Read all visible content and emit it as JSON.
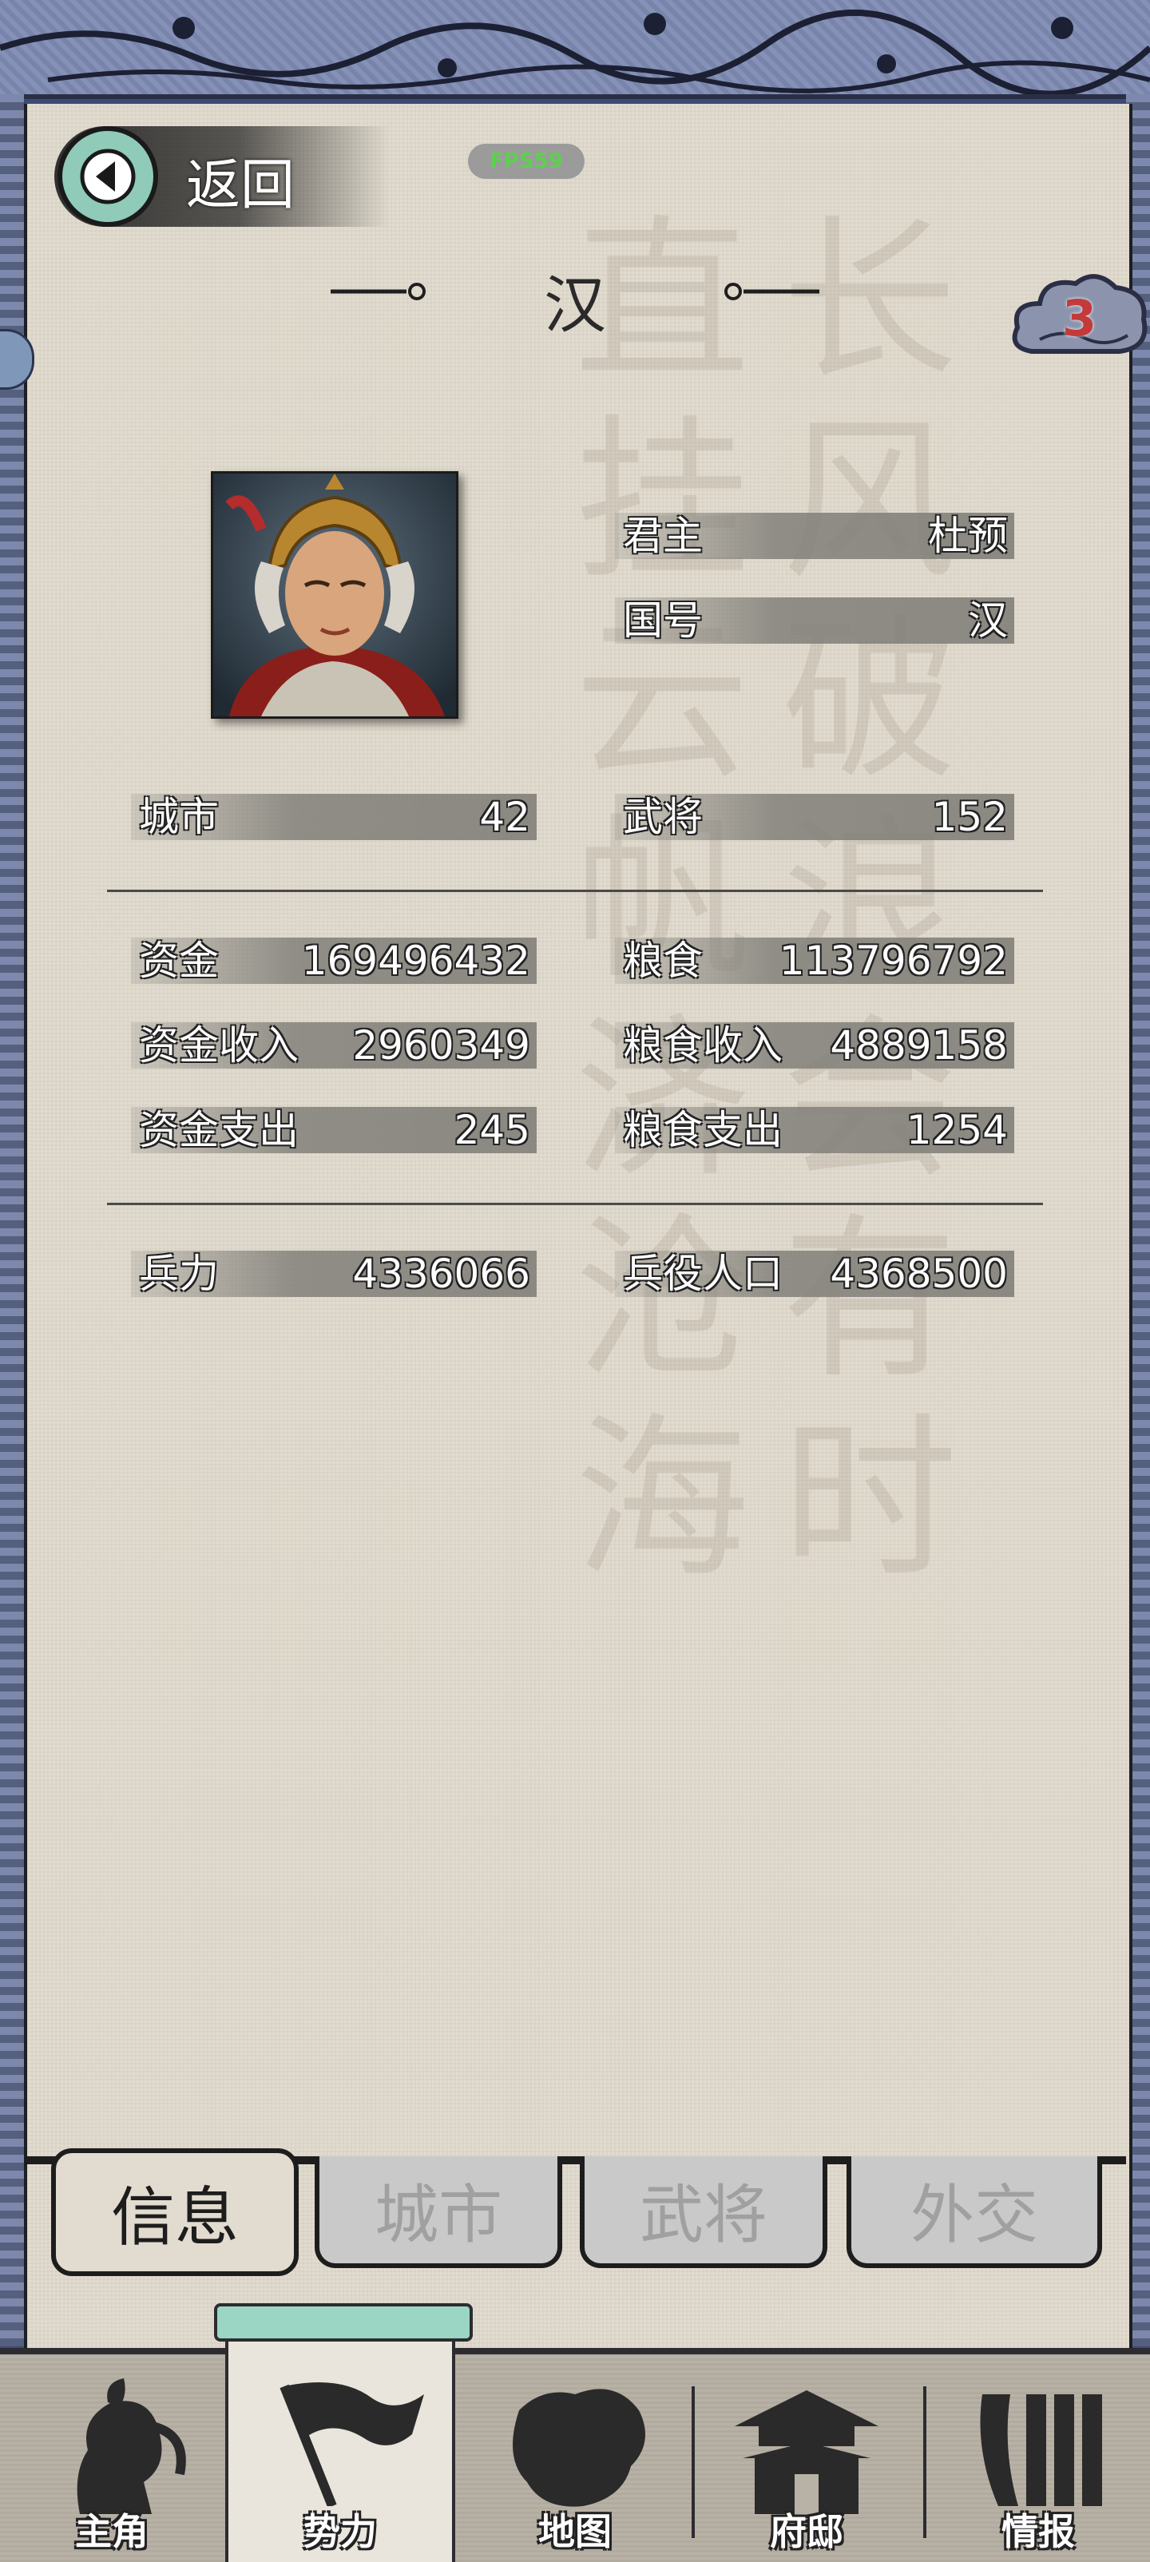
{
  "header": {
    "back_label": "返回",
    "fps_label": "FPS59",
    "nation_title": "汉",
    "notification_count": "3"
  },
  "ruler": {
    "rows": [
      {
        "label": "君主",
        "value": "杜预"
      },
      {
        "label": "国号",
        "value": "汉"
      }
    ]
  },
  "stats": {
    "row1": [
      {
        "label": "城市",
        "value": "42"
      },
      {
        "label": "武将",
        "value": "152"
      }
    ],
    "row2": [
      {
        "label": "资金",
        "value": "169496432"
      },
      {
        "label": "粮食",
        "value": "113796792"
      }
    ],
    "row3": [
      {
        "label": "资金收入",
        "value": "2960349"
      },
      {
        "label": "粮食收入",
        "value": "4889158"
      }
    ],
    "row4": [
      {
        "label": "资金支出",
        "value": "245"
      },
      {
        "label": "粮食支出",
        "value": "1254"
      }
    ],
    "row5": [
      {
        "label": "兵力",
        "value": "4336066"
      },
      {
        "label": "兵役人口",
        "value": "4368500"
      }
    ]
  },
  "tabs": [
    {
      "label": "信息",
      "active": true
    },
    {
      "label": "城市",
      "active": false
    },
    {
      "label": "武将",
      "active": false
    },
    {
      "label": "外交",
      "active": false
    }
  ],
  "bottom_nav": [
    {
      "label": "主角",
      "icon": "hero-head-icon"
    },
    {
      "label": "势力",
      "icon": "flag-icon",
      "selected": true
    },
    {
      "label": "地图",
      "icon": "map-icon"
    },
    {
      "label": "府邸",
      "icon": "mansion-icon"
    },
    {
      "label": "情报",
      "icon": "bamboo-scroll-icon"
    }
  ],
  "colors": {
    "paper": "#e2dcd0",
    "border_blue": "#7f8bb4",
    "back_circle": "#8fcbb8",
    "badge_red": "#c43a3a",
    "fps_green": "#5ecf4f"
  }
}
